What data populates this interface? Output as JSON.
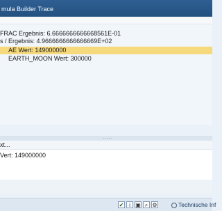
{
  "window": {
    "title": "mula Builder Trace"
  },
  "trace": {
    "lines": [
      "FRAC  Ergebnis:  6.6666666666668561E-01",
      "s  /  Ergebnis:  4.9666666666666669E+02",
      "AE  Wert:  149000000",
      "EARTH_MOON  Wert:  300000"
    ],
    "selected_index": 2
  },
  "details": {
    "header": "xt...",
    "value_line": "Vert:  149000000"
  },
  "statusbar": {
    "tech_label": "Technische Inf",
    "icons": [
      "check-icon",
      "info-icon",
      "save-icon",
      "search-icon",
      "settings-icon"
    ]
  }
}
